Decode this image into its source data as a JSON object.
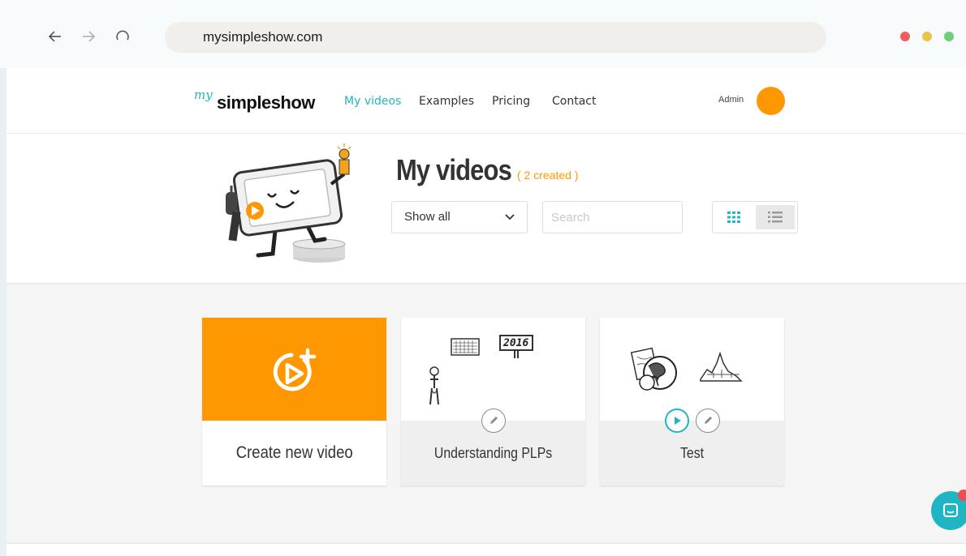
{
  "browser": {
    "url": "mysimpleshow.com",
    "window_dot_colors": [
      "#f05d5d",
      "#e9c24a",
      "#6dcf7a"
    ]
  },
  "nav": {
    "logo_prefix": "my",
    "logo_brand": "simpleshow",
    "items": [
      {
        "label": "My videos",
        "active": true
      },
      {
        "label": "Examples"
      },
      {
        "label": "Pricing"
      },
      {
        "label": "Contact"
      }
    ],
    "user_name": "Admin"
  },
  "header": {
    "title": "My videos",
    "created_count": "( 2 created )",
    "filter_value": "Show all",
    "search_placeholder": "Search"
  },
  "videos": [
    {
      "title": "Create new video",
      "type": "create"
    },
    {
      "title": "Understanding PLPs",
      "type": "video"
    },
    {
      "title": "Test",
      "type": "video"
    }
  ],
  "colors": {
    "accent": "#1fb5c3",
    "orange": "#ff9800"
  }
}
